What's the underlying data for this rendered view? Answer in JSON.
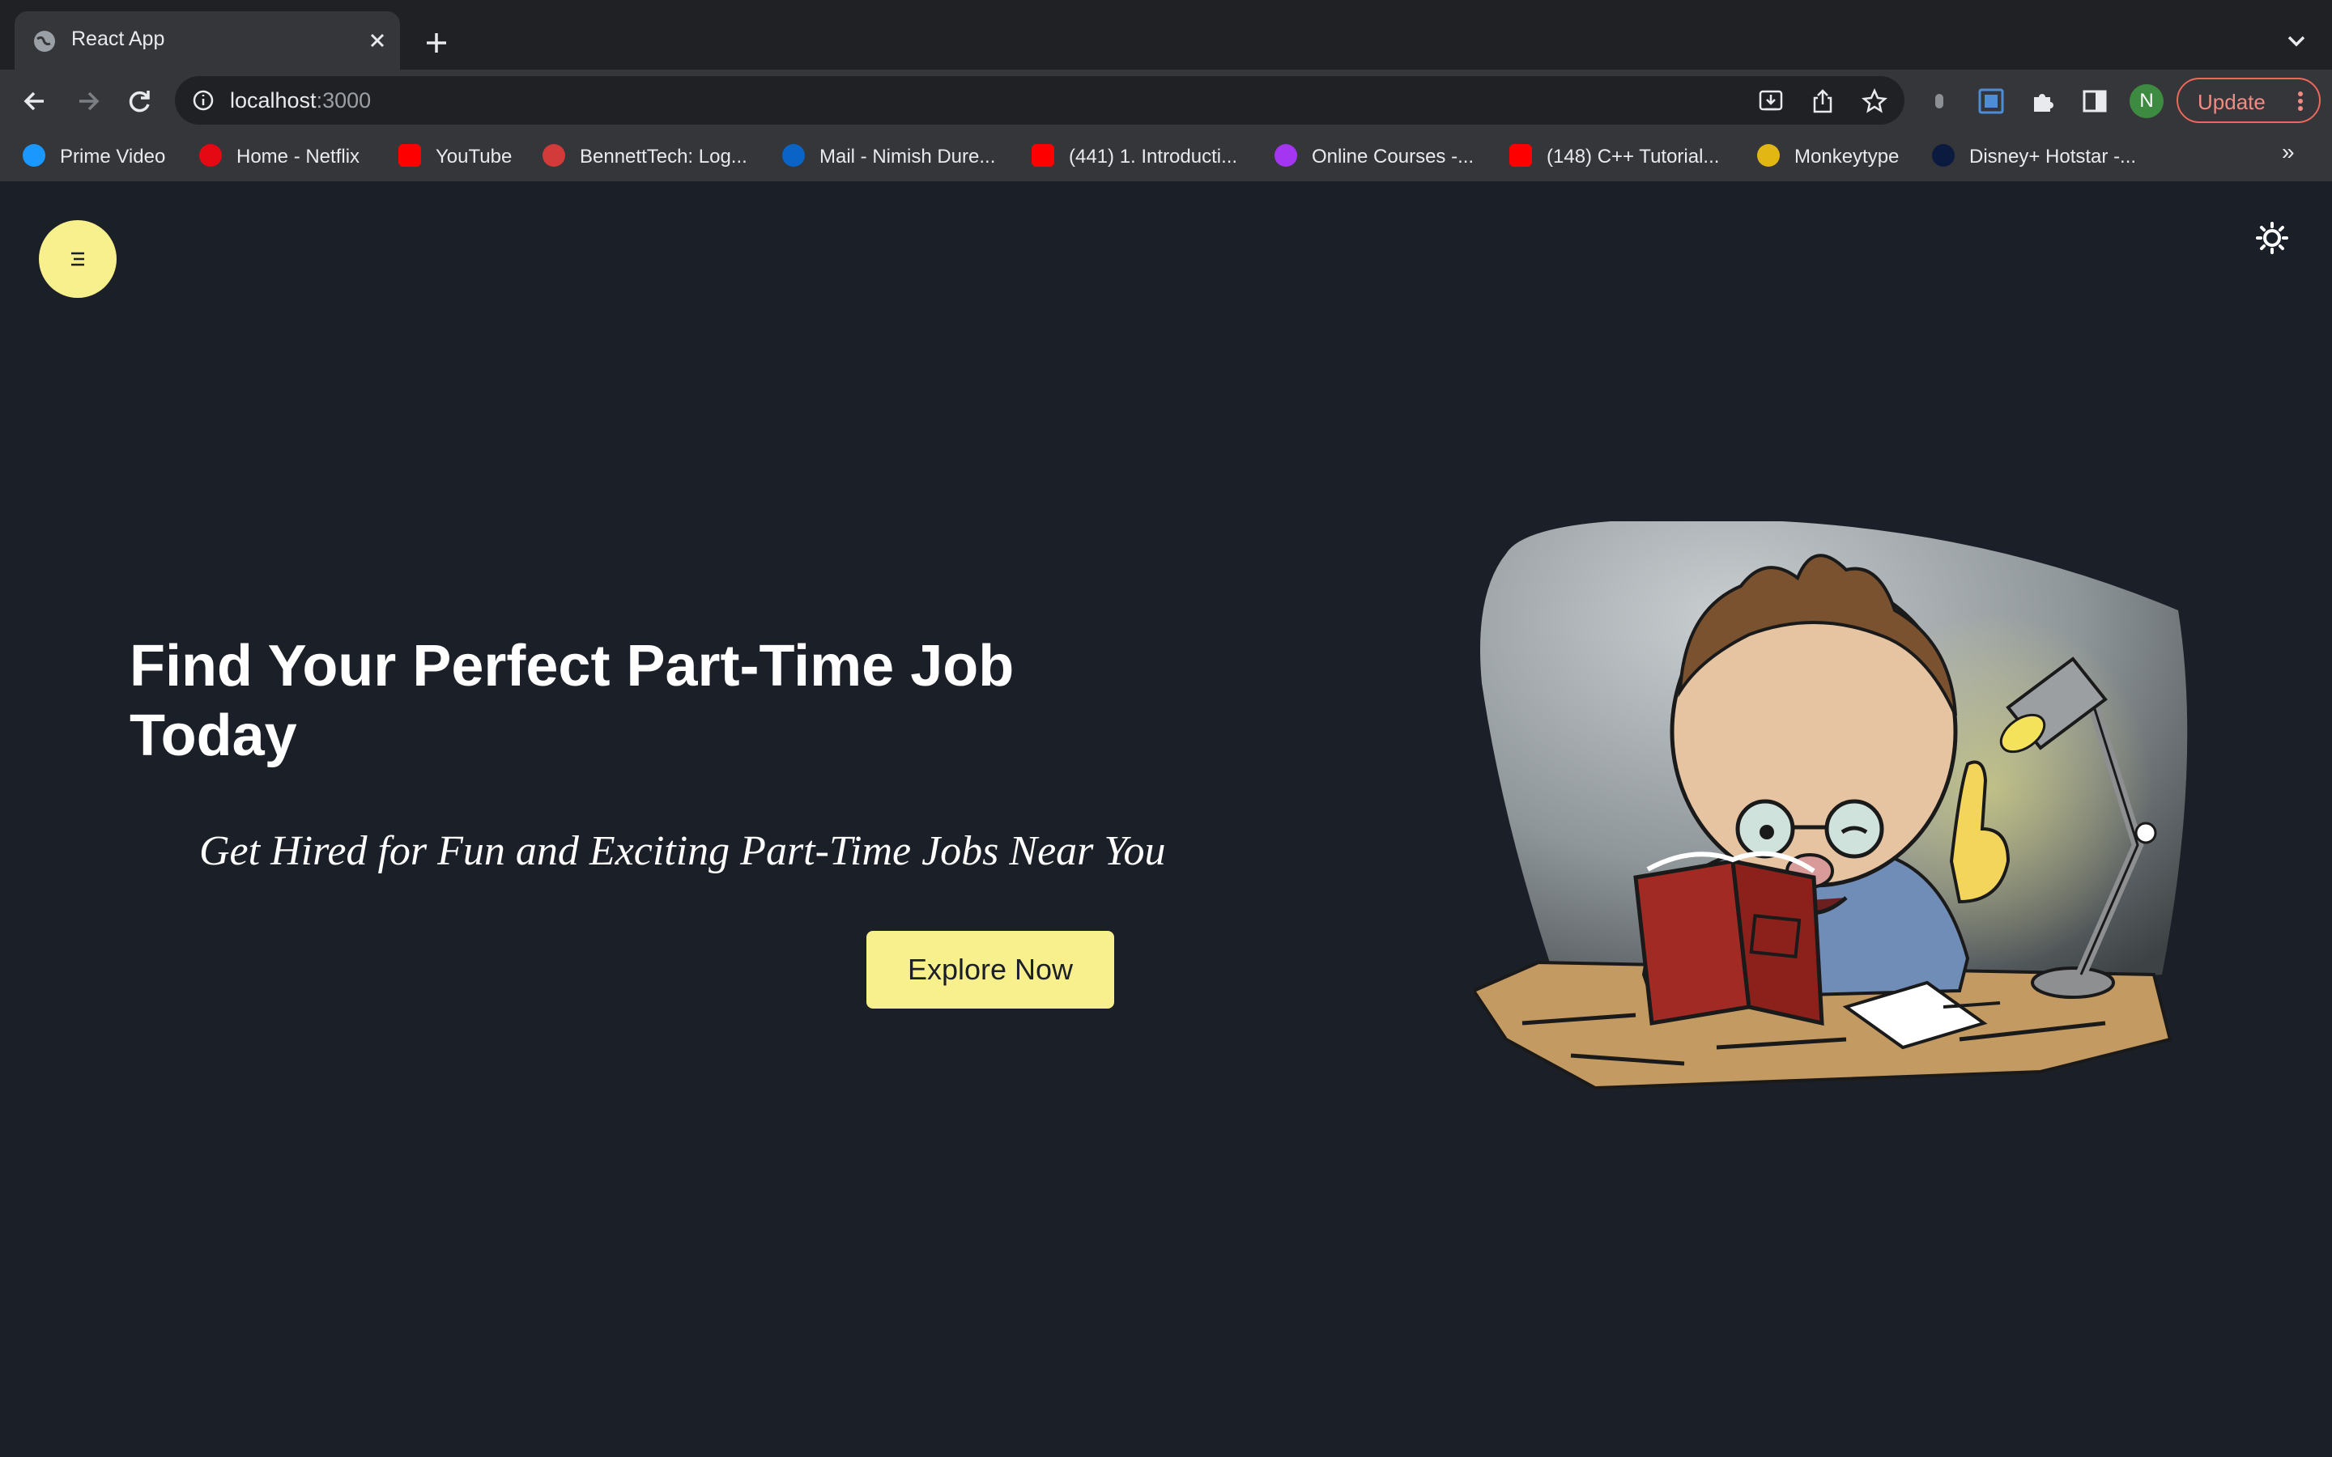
{
  "browser": {
    "tab_title": "React App",
    "url_host": "localhost",
    "url_port": ":3000",
    "update_label": "Update",
    "avatar_initial": "N",
    "bookmarks": [
      {
        "label": "Prime Video",
        "icon": "prime-video-icon",
        "color": "#1a98ff"
      },
      {
        "label": "Home - Netflix",
        "icon": "netflix-icon",
        "color": "#e50914"
      },
      {
        "label": "YouTube",
        "icon": "youtube-icon",
        "color": "#ff0000"
      },
      {
        "label": "BennettTech: Log...",
        "icon": "bennett-icon",
        "color": "#d33a3a"
      },
      {
        "label": "Mail - Nimish Dure...",
        "icon": "outlook-icon",
        "color": "#0a64c8"
      },
      {
        "label": "(441) 1. Introducti...",
        "icon": "youtube-icon",
        "color": "#ff0000"
      },
      {
        "label": "Online Courses -...",
        "icon": "udemy-icon",
        "color": "#a435f0"
      },
      {
        "label": "(148) C++ Tutorial...",
        "icon": "youtube-icon",
        "color": "#ff0000"
      },
      {
        "label": "Monkeytype",
        "icon": "monkeytype-icon",
        "color": "#e2b714"
      },
      {
        "label": "Disney+ Hotstar -...",
        "icon": "hotstar-icon",
        "color": "#0b1a3f"
      }
    ],
    "bookmarks_overflow": "»"
  },
  "page": {
    "hero_title": "Find Your Perfect Part-Time Job Today",
    "hero_subtitle": "Get Hired for Fun and Exciting Part-Time Jobs Near You",
    "cta_label": "Explore Now"
  },
  "colors": {
    "accent": "#f8ef8d",
    "background": "#1b1f28"
  }
}
